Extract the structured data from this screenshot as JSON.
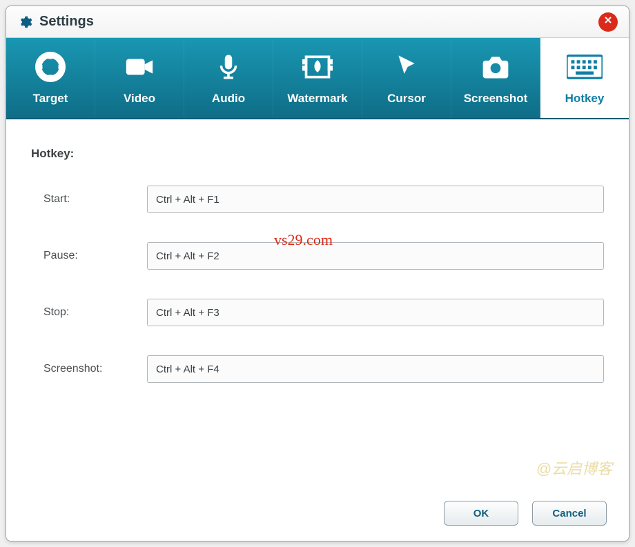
{
  "window": {
    "title": "Settings"
  },
  "tabs": [
    {
      "id": "target",
      "label": "Target",
      "icon": "target-icon"
    },
    {
      "id": "video",
      "label": "Video",
      "icon": "video-icon"
    },
    {
      "id": "audio",
      "label": "Audio",
      "icon": "audio-icon"
    },
    {
      "id": "watermark",
      "label": "Watermark",
      "icon": "watermark-icon"
    },
    {
      "id": "cursor",
      "label": "Cursor",
      "icon": "cursor-icon"
    },
    {
      "id": "screenshot",
      "label": "Screenshot",
      "icon": "screenshot-icon"
    },
    {
      "id": "hotkey",
      "label": "Hotkey",
      "icon": "keyboard-icon",
      "active": true
    }
  ],
  "section": {
    "title": "Hotkey:"
  },
  "fields": [
    {
      "label": "Start:",
      "value": "Ctrl + Alt + F1"
    },
    {
      "label": "Pause:",
      "value": "Ctrl + Alt + F2"
    },
    {
      "label": "Stop:",
      "value": "Ctrl + Alt + F3"
    },
    {
      "label": "Screenshot:",
      "value": "Ctrl + Alt + F4"
    }
  ],
  "buttons": {
    "ok": "OK",
    "cancel": "Cancel"
  },
  "overlay": {
    "url": "vs29.com",
    "credit": "@云启博客"
  }
}
